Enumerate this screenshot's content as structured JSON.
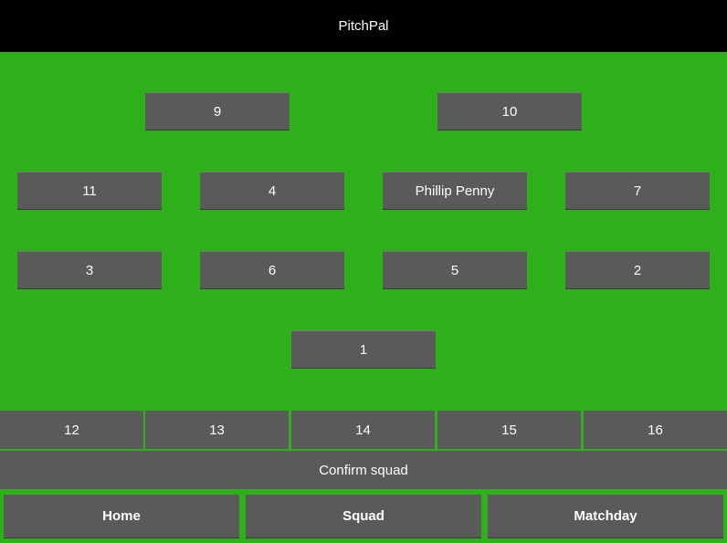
{
  "header": {
    "title": "PitchPal"
  },
  "pitch": {
    "slots": [
      {
        "label": "9"
      },
      {
        "label": "10"
      },
      {
        "label": "11"
      },
      {
        "label": "4"
      },
      {
        "label": "Phillip Penny"
      },
      {
        "label": "7"
      },
      {
        "label": "3"
      },
      {
        "label": "6"
      },
      {
        "label": "5"
      },
      {
        "label": "2"
      },
      {
        "label": "1"
      }
    ]
  },
  "bench": {
    "subs": [
      {
        "label": "12"
      },
      {
        "label": "13"
      },
      {
        "label": "14"
      },
      {
        "label": "15"
      },
      {
        "label": "16"
      }
    ]
  },
  "actions": {
    "confirm_label": "Confirm squad"
  },
  "nav": {
    "items": [
      {
        "label": "Home"
      },
      {
        "label": "Squad"
      },
      {
        "label": "Matchday"
      }
    ]
  },
  "colors": {
    "pitch": "#2eb01b",
    "header": "#000000",
    "button": "#5a5a5a",
    "text": "#ffffff"
  }
}
